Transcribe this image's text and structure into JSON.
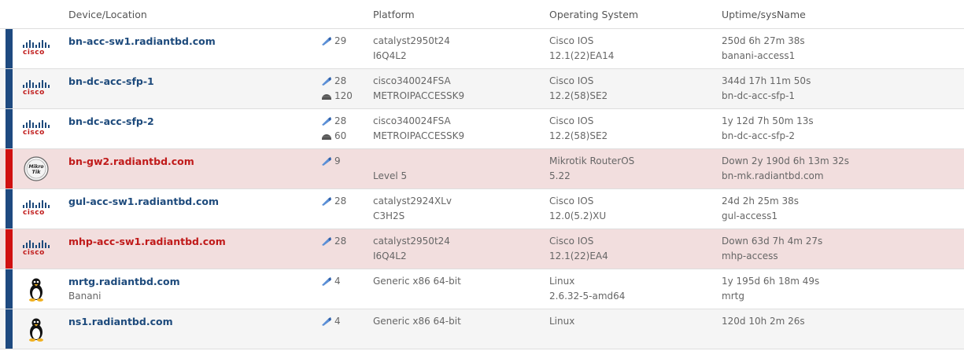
{
  "header": {
    "device": "Device/Location",
    "platform": "Platform",
    "os": "Operating System",
    "uptime": "Uptime/sysName"
  },
  "logos": {
    "cisco_text": "cisco",
    "mikrotik_text": "Mikro Tik"
  },
  "colors": {
    "accent": "#1e4a80",
    "alert": "#d01010",
    "down_row_bg": "#f2dede",
    "link": "#1d4a7c",
    "down_link": "#c01a1a"
  },
  "devices": [
    {
      "hostname": "bn-acc-sw1.radiantbd.com",
      "location": "",
      "ports": "29",
      "sensors": "",
      "platform": "catalyst2950t24",
      "hardware": "I6Q4L2",
      "os": "Cisco IOS",
      "version": "12.1(22)EA14",
      "uptime": "250d 6h 27m 38s",
      "sysname": "banani-access1",
      "status": "up",
      "vendor_icon": "cisco-icon"
    },
    {
      "hostname": "bn-dc-acc-sfp-1",
      "location": "",
      "ports": "28",
      "sensors": "120",
      "platform": "cisco340024FSA",
      "hardware": "METROIPACCESSK9",
      "os": "Cisco IOS",
      "version": "12.2(58)SE2",
      "uptime": "344d 17h 11m 50s",
      "sysname": "bn-dc-acc-sfp-1",
      "status": "up",
      "vendor_icon": "cisco-icon"
    },
    {
      "hostname": "bn-dc-acc-sfp-2",
      "location": "",
      "ports": "28",
      "sensors": "60",
      "platform": "cisco340024FSA",
      "hardware": "METROIPACCESSK9",
      "os": "Cisco IOS",
      "version": "12.2(58)SE2",
      "uptime": "1y 12d 7h 50m 13s",
      "sysname": "bn-dc-acc-sfp-2",
      "status": "up",
      "vendor_icon": "cisco-icon"
    },
    {
      "hostname": "bn-gw2.radiantbd.com",
      "location": "",
      "ports": "9",
      "sensors": "",
      "platform": "",
      "hardware": "Level 5",
      "os": "Mikrotik RouterOS",
      "version": "5.22",
      "uptime": "Down 2y 190d 6h 13m 32s",
      "sysname": "bn-mk.radiantbd.com",
      "status": "down",
      "vendor_icon": "mikrotik-icon"
    },
    {
      "hostname": "gul-acc-sw1.radiantbd.com",
      "location": "",
      "ports": "28",
      "sensors": "",
      "platform": "catalyst2924XLv",
      "hardware": "C3H2S",
      "os": "Cisco IOS",
      "version": "12.0(5.2)XU",
      "uptime": "24d 2h 25m 38s",
      "sysname": "gul-access1",
      "status": "up",
      "vendor_icon": "cisco-icon"
    },
    {
      "hostname": "mhp-acc-sw1.radiantbd.com",
      "location": "",
      "ports": "28",
      "sensors": "",
      "platform": "catalyst2950t24",
      "hardware": "I6Q4L2",
      "os": "Cisco IOS",
      "version": "12.1(22)EA4",
      "uptime": "Down 63d 7h 4m 27s",
      "sysname": "mhp-access",
      "status": "down",
      "vendor_icon": "cisco-icon"
    },
    {
      "hostname": "mrtg.radiantbd.com",
      "location": "Banani",
      "ports": "4",
      "sensors": "",
      "platform": "Generic x86 64-bit",
      "hardware": "",
      "os": "Linux",
      "version": "2.6.32-5-amd64",
      "uptime": "1y 195d 6h 18m 49s",
      "sysname": "mrtg",
      "status": "up",
      "vendor_icon": "linux-tux-icon"
    },
    {
      "hostname": "ns1.radiantbd.com",
      "location": "",
      "ports": "4",
      "sensors": "",
      "platform": "Generic x86 64-bit",
      "hardware": "",
      "os": "Linux",
      "version": "",
      "uptime": "120d 10h 2m 26s",
      "sysname": "",
      "status": "up",
      "vendor_icon": "linux-tux-icon"
    }
  ]
}
